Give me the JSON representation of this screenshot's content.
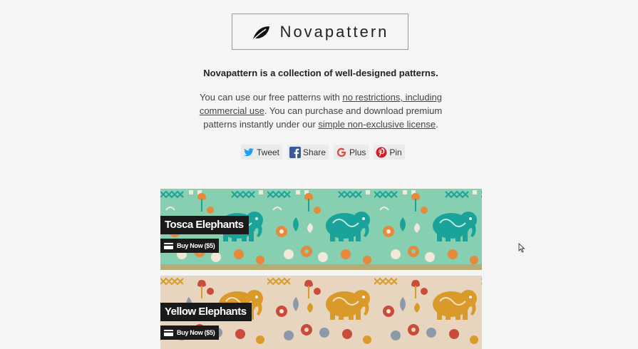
{
  "site": {
    "logo_text": "Novapattern",
    "tagline": "Novapattern is a collection of well-designed patterns.",
    "desc_1": "You can use our free patterns with ",
    "link_1": "no restrictions, including commercial use",
    "desc_2": ". You can purchase and download premium patterns instantly under our ",
    "link_2": "simple non-exclusive license",
    "desc_3": "."
  },
  "share": [
    {
      "label": "Tweet",
      "icon": "twitter-icon",
      "color": "#1da1f2"
    },
    {
      "label": "Share",
      "icon": "facebook-icon",
      "color": "#3b5998"
    },
    {
      "label": "Plus",
      "icon": "google-plus-icon",
      "color": "#dd4b39"
    },
    {
      "label": "Pin",
      "icon": "pinterest-icon",
      "color": "#cb2027"
    }
  ],
  "patterns": [
    {
      "title": "Tosca Elephants",
      "buy_label": "Buy Now ($5)",
      "bg": "#86cfb0",
      "accent": "#1aa39a",
      "secondary": "#e6893a"
    },
    {
      "title": "Yellow Elephants",
      "buy_label": "Buy Now ($5)",
      "bg": "#e8d5c0",
      "accent": "#d99a2a",
      "secondary": "#c94b3a"
    }
  ]
}
